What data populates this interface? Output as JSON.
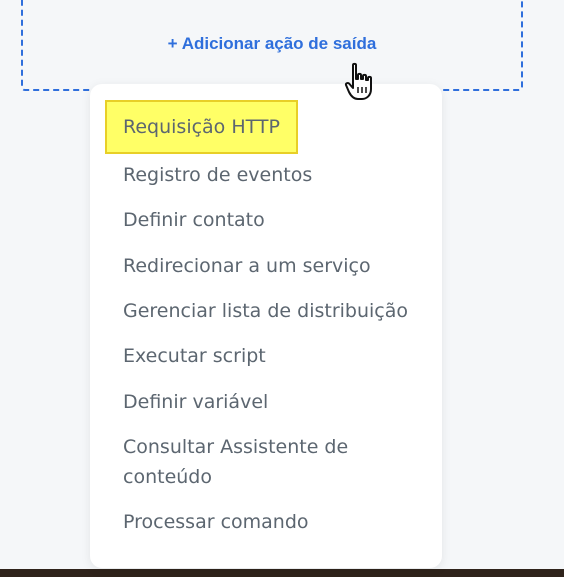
{
  "action_zone": {
    "add_label": "+ Adicionar ação de saída"
  },
  "menu": {
    "items": [
      {
        "label": "Requisição HTTP",
        "highlighted": true
      },
      {
        "label": "Registro de eventos"
      },
      {
        "label": "Definir contato"
      },
      {
        "label": "Redirecionar a um serviço"
      },
      {
        "label": "Gerenciar lista de distribuição"
      },
      {
        "label": "Executar script"
      },
      {
        "label": "Definir variável"
      },
      {
        "label": "Consultar Assistente de"
      },
      {
        "label": "conteúdo"
      },
      {
        "label": "Processar comando"
      }
    ]
  },
  "colors": {
    "accent": "#2f6fdc",
    "highlight": "#ffff66",
    "menu_text": "#5c6670"
  }
}
